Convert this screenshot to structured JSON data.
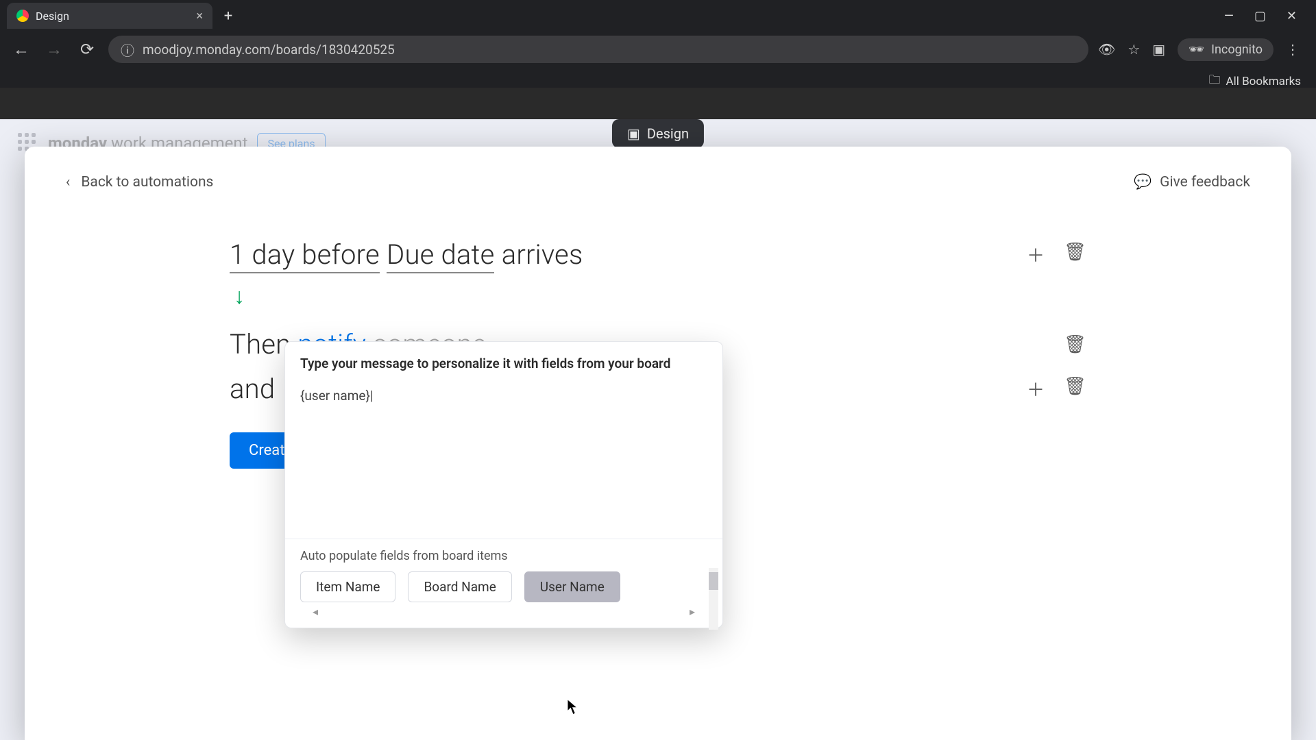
{
  "browser": {
    "tab_title": "Design",
    "url": "moodjoy.monday.com/boards/1830420525",
    "incognito_label": "Incognito",
    "all_bookmarks": "All Bookmarks"
  },
  "bg": {
    "app_title_bold": "monday",
    "app_title_rest": " work management",
    "see_plans": "See plans",
    "design_pill": "Design"
  },
  "modal": {
    "back": "Back to automations",
    "feedback": "Give feedback"
  },
  "rules": {
    "trigger_time": "1 day before",
    "trigger_field": "Due date",
    "trigger_tail": " arrives",
    "then_label": "Then ",
    "notify_label": "notify",
    "someone_label": "someone",
    "and_label": "and ",
    "create_btn": "Creat"
  },
  "popover": {
    "title": "Type your message to personalize it with fields from your board",
    "editor_value": "{user name}|",
    "autofill_label": "Auto populate fields from board items",
    "chips": [
      "Item Name",
      "Board Name",
      "User Name"
    ]
  }
}
